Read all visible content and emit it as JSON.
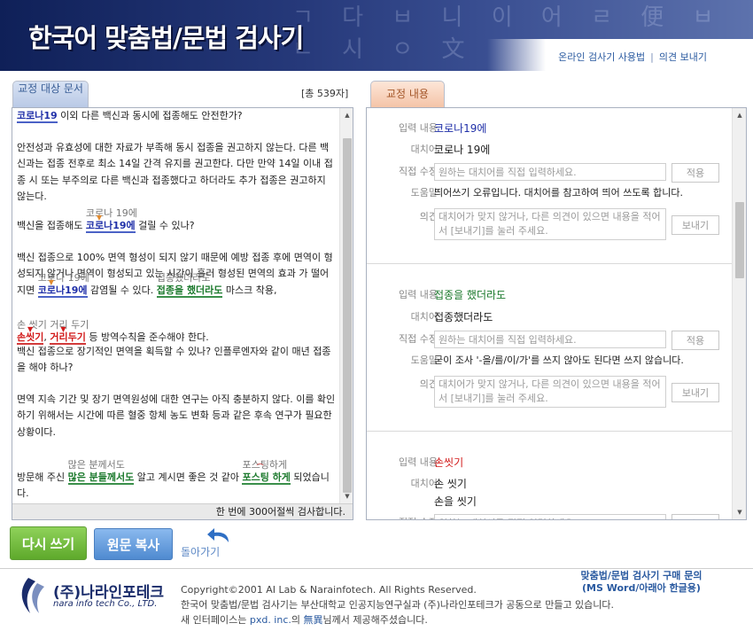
{
  "header": {
    "title": "한국어 맞춤법/문법 검사기",
    "deco_text": "ㄱ 다 ㅂ 니 이 어 ㄹ 便 ㅂ ㄴ 시 ㅇ 文",
    "links": [
      "온라인 검사기 사용법",
      "의견 보내기"
    ],
    "link_separator": "|"
  },
  "left_panel": {
    "tab": "교정 대상 문서",
    "count": "[총 539자]",
    "footer": "한 번에 300어절씩 검사합니다.",
    "lines": [
      {
        "hl": "코로나19",
        "rest": " 이외 다른 백신과 동시에 접종해도 안전한가?"
      },
      {
        "text": "안전성과 유효성에 대한 자료가 부족해 동시 접종을 권고하지 않는다. 다른 백신과는 접종 전후로 최소 14일 간격 유지를 권고한다. 다만 만약 14일 이내 접종 시 또는 부주의로 다른 백신과 접종했다고 하더라도 추가 접종은 권고하지 않는다."
      },
      {
        "pre": "백신을 접종해도 ",
        "hl": "코로나19에",
        "sugg": "코로나 19에",
        "rest": " 걸릴 수 있나?"
      },
      {
        "text_a": "백신 접종으로 100% 면역 형성이 되지 않기 때문에 예방 접종 후에 면역이 형성되지 않거나 면역이 형성되고 있는 시간이 흘러 형성된 면역의 효과 가 떨어지면 ",
        "hl1": "코로나19에",
        "sugg1": "코로나 19에",
        "mid": " 감염될 수 있다. ",
        "hl2": "접종을 했더라도",
        "sugg2": "접종했더라도",
        "rest": " 마스크 착용,"
      },
      {
        "hl1": "손씻기",
        "sugg1": "손 씻기",
        "sep": ", ",
        "hl2": "거리두기",
        "sugg2": "거리 두기",
        "rest": " 등 방역수칙을 준수해야 한다."
      },
      {
        "text": "백신 접종으로 장기적인 면역을 획득할 수 있나? 인플루엔자와 같이 매년 접종을 해야 하나?"
      },
      {
        "text": "면역 지속 기간 및 장기 면역원성에 대한 연구는 아직 충분하지 않다. 이를 확인하기 위해서는 시간에 따른 혈중 항체 농도 변화 등과 같은 후속 연구가 필요한 상황이다."
      },
      {
        "pre": "방문해 주신 ",
        "hl1": "많은 분들께서도",
        "sugg1": "많은 분께서도",
        "mid": " 알고 계시면 좋은 것 같아 ",
        "hl2": "포스팅 하게",
        "sugg2": "포스팅하게",
        "rest": " 되었습니다."
      }
    ]
  },
  "right_panel": {
    "tab": "교정 내용",
    "labels": {
      "input": "입력 내용",
      "replace": "대치어",
      "direct": "직접 수정",
      "help": "도움말",
      "opinion": "의견"
    },
    "direct_placeholder": "원하는 대치어를 직접 입력하세요.",
    "apply_label": "적용",
    "opinion_placeholder": "대치어가 맞지 않거나, 다른 의견이 있으면 내용을 적어서 [보내기]를 눌러 주세요.",
    "send_label": "보내기",
    "cards": [
      {
        "input": "코로나19에",
        "input_color": "blue",
        "replace": [
          "코로나 19에"
        ],
        "help": "띄어쓰기 오류입니다. 대치어를 참고하여 띄어 쓰도록 합니다."
      },
      {
        "input": "접종을 했더라도",
        "input_color": "green",
        "replace": [
          "접종했더라도"
        ],
        "help": "굳이 조사 '-을/를/이/가'를 쓰지 않아도 된다면 쓰지 않습니다."
      },
      {
        "input": "손씻기",
        "input_color": "red",
        "replace": [
          "손 씻기",
          "손을 씻기"
        ]
      }
    ]
  },
  "buttons": {
    "rewrite": "다시 쓰기",
    "copy": "원문 복사",
    "back": "돌아가기"
  },
  "footer": {
    "logo_kr": "(주)나라인포테크",
    "logo_en": "nara info tech Co., LTD.",
    "copyright": "Copyright©2001 AI Lab & Narainfotech. All Rights Reserved.",
    "line2": "한국어 맞춤법/문법 검사기는 부산대학교 인공지능연구실과 (주)나라인포테크가 공동으로 만들고 있습니다.",
    "line3_pre": "새 인터페이스는 ",
    "line3_link1": "pxd. inc.",
    "line3_mid": "의 ",
    "line3_link2": "無異",
    "line3_post": "님께서 제공해주셨습니다.",
    "purchase_line1": "맞춤법/문법 검사기 구매 문의",
    "purchase_line2": "(MS Word/아래아 한글용)"
  },
  "colors": {
    "header_dark": "#0f2058",
    "blue_error": "#1f2fa8",
    "green_error": "#1c7a2d",
    "red_error": "#d21a1a",
    "rewrite_green": "#6bb535",
    "copy_blue": "#5b95d8"
  },
  "icons": [
    "back-arrow-icon",
    "company-logo-icon"
  ]
}
